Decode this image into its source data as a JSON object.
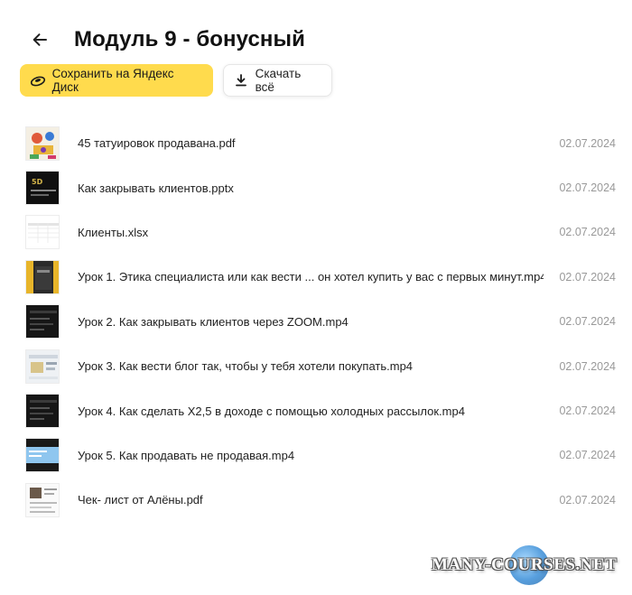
{
  "header": {
    "title": "Модуль 9 - бонусный"
  },
  "actions": {
    "save_label": "Сохранить на Яндекс Диск",
    "download_label": "Скачать всё"
  },
  "files": [
    {
      "name": "45 татуировок продавана.pdf",
      "date": "02.07.2024",
      "thumb": "pdf-tattoo"
    },
    {
      "name": "Как закрывать клиентов.pptx",
      "date": "02.07.2024",
      "thumb": "pptx-dark"
    },
    {
      "name": "Клиенты.xlsx",
      "date": "02.07.2024",
      "thumb": "xlsx-sheet"
    },
    {
      "name": "Урок 1. Этика специалиста или как вести ... он хотел купить у вас с первых минут.mp4",
      "date": "02.07.2024",
      "thumb": "video-yellow"
    },
    {
      "name": "Урок 2. Как закрывать клиентов через ZOOM.mp4",
      "date": "02.07.2024",
      "thumb": "video-dark"
    },
    {
      "name": "Урок 3. Как вести блог так, чтобы у тебя хотели покупать.mp4",
      "date": "02.07.2024",
      "thumb": "video-light"
    },
    {
      "name": "Урок 4. Как сделать Х2,5 в доходе с помощью холодных рассылок.mp4",
      "date": "02.07.2024",
      "thumb": "video-dark"
    },
    {
      "name": "Урок 5. Как продавать не продавая.mp4",
      "date": "02.07.2024",
      "thumb": "video-blue"
    },
    {
      "name": "Чек- лист от Алёны.pdf",
      "date": "02.07.2024",
      "thumb": "pdf-checklist"
    }
  ],
  "watermark": {
    "text": "MANY-COURSES.NET"
  },
  "colors": {
    "accent": "#ffdb4d",
    "date": "#999999"
  }
}
